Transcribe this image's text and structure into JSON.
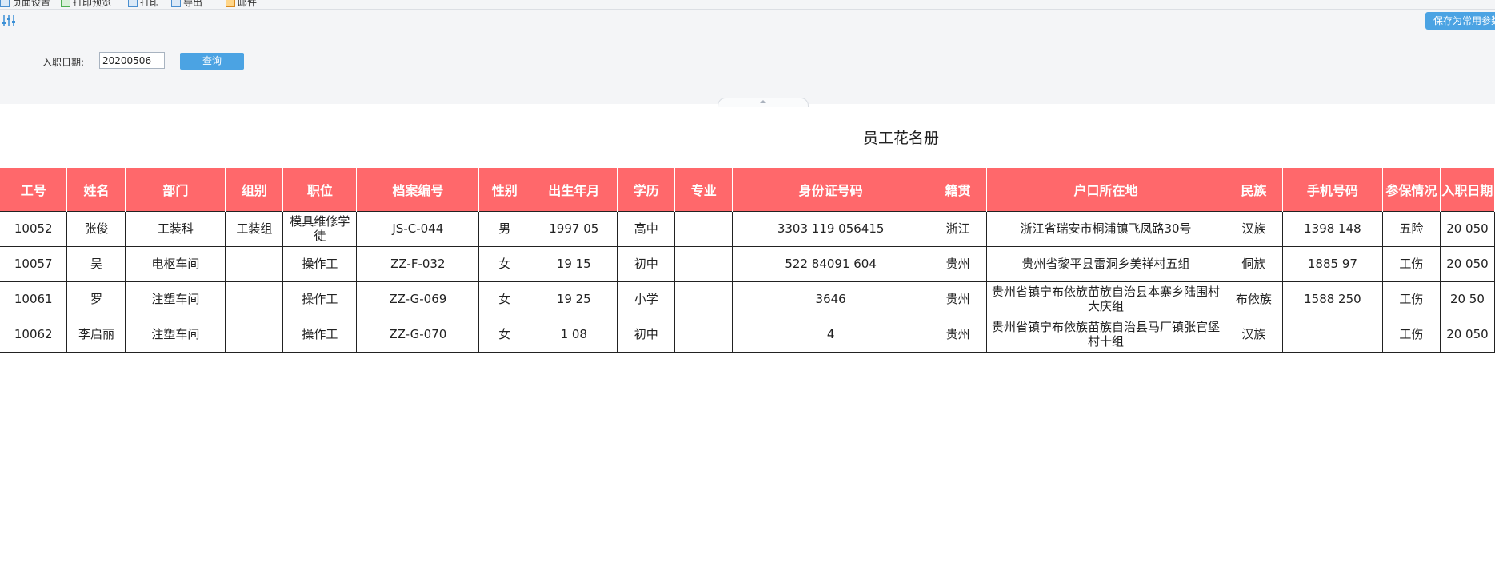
{
  "toolbar": {
    "items": [
      "页面设置",
      "打印预览",
      "打印",
      "导出",
      "邮件"
    ],
    "save_params_label": "保存为常用参数"
  },
  "params": {
    "hire_date_label": "入职日期:",
    "hire_date_value": "20200506",
    "query_label": "查询"
  },
  "report": {
    "title": "员工花名册",
    "columns": [
      "工号",
      "姓名",
      "部门",
      "组别",
      "职位",
      "档案编号",
      "性别",
      "出生年月",
      "学历",
      "专业",
      "身份证号码",
      "籍贯",
      "户口所在地",
      "民族",
      "手机号码",
      "参保情况",
      "入职日期"
    ],
    "rows": [
      [
        "10052",
        "张俊",
        "工装科",
        "工装组",
        "模具维修学徒",
        "JS-C-044",
        "男",
        "1997  05",
        "高中",
        "",
        "3303  119  056415",
        "浙江",
        "浙江省瑞安市桐浦镇飞凤路30号",
        "汉族",
        "1398  148",
        "五险",
        "20  050"
      ],
      [
        "10057",
        "吴",
        "电枢车间",
        "",
        "操作工",
        "ZZ-F-032",
        "女",
        "19  15",
        "初中",
        "",
        "522  84091  604",
        "贵州",
        "贵州省黎平县雷洞乡美祥村五组",
        "侗族",
        "1885  97",
        "工伤",
        "20  050"
      ],
      [
        "10061",
        "罗",
        "注塑车间",
        "",
        "操作工",
        "ZZ-G-069",
        "女",
        "19  25",
        "小学",
        "",
        "3646",
        "贵州",
        "贵州省镇宁布依族苗族自治县本寨乡陆围村大庆组",
        "布依族",
        "1588  250",
        "工伤",
        "20  50"
      ],
      [
        "10062",
        "李启丽",
        "注塑车间",
        "",
        "操作工",
        "ZZ-G-070",
        "女",
        "1  08",
        "初中",
        "",
        "4",
        "贵州",
        "贵州省镇宁布依族苗族自治县马厂镇张官堡村十组",
        "汉族",
        "",
        "工伤",
        "20  050"
      ]
    ]
  }
}
